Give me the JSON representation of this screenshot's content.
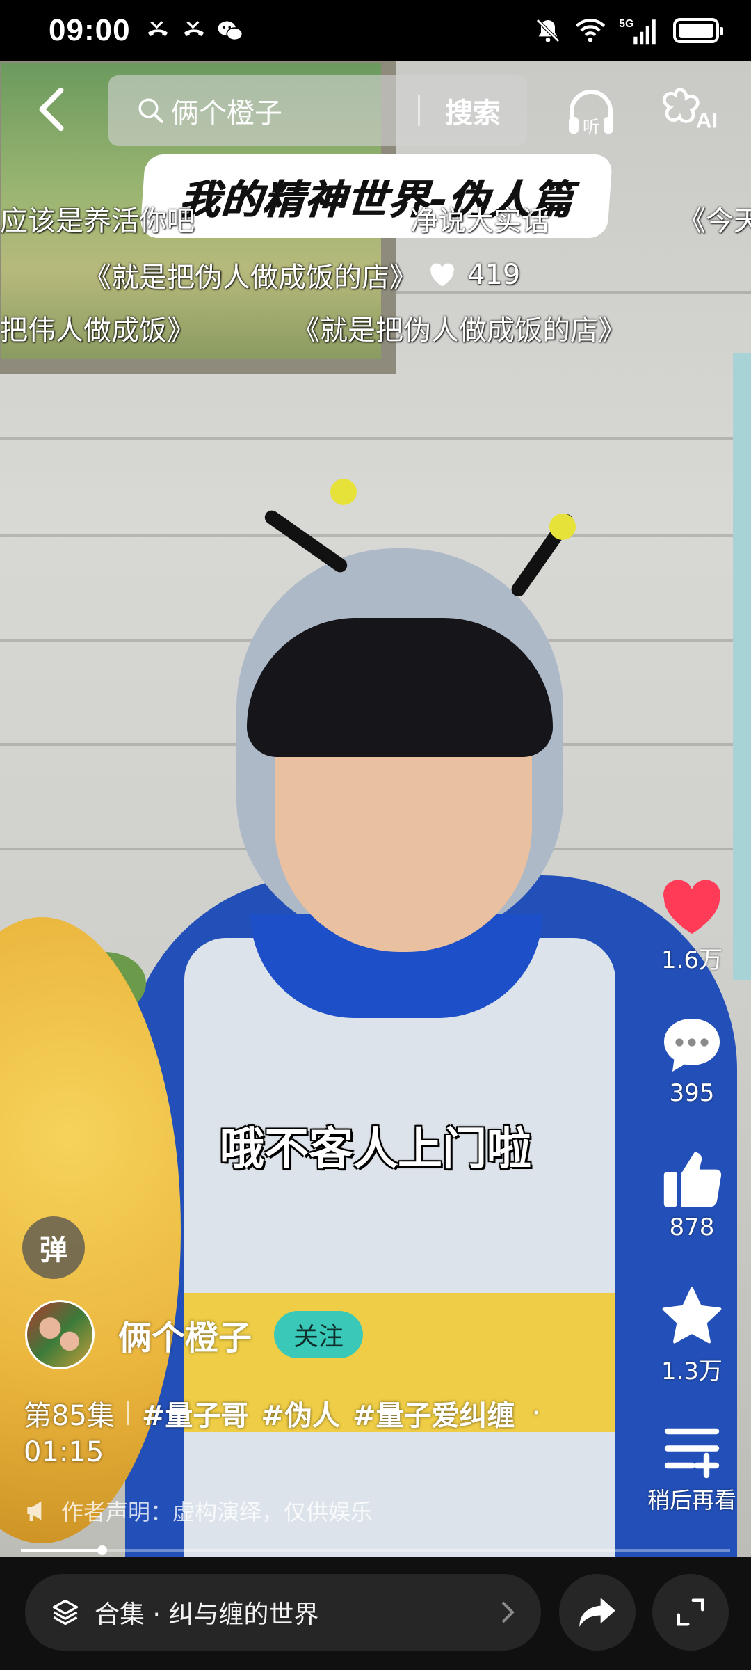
{
  "status_bar": {
    "time": "09:00",
    "left_icons": [
      "missed-call-icon",
      "missed-call-icon",
      "wechat-icon"
    ],
    "right_icons": [
      "mute-icon",
      "wifi-icon",
      "5g-signal-icon",
      "battery-icon"
    ],
    "network": "5G"
  },
  "top_bar": {
    "search_query": "俩个橙子",
    "search_button": "搜索",
    "listen_label": "听",
    "ai_label": "AI"
  },
  "video": {
    "title_sticker": "我的精神世界-伪人篇",
    "subtitle": "哦不客人上门啦"
  },
  "danmaku": {
    "row1": [
      "应该是养活你吧",
      "净说大实话",
      "《今天"
    ],
    "row2_text": "《就是把伪人做成饭的店》",
    "row2_likes": "419",
    "row3": [
      "把伟人做成饭》",
      "《就是把伪人做成饭的店》"
    ]
  },
  "actions": {
    "likes": "1.6万",
    "comments": "395",
    "recommends": "878",
    "favorites": "1.3万",
    "watch_later": "稍后再看"
  },
  "info": {
    "danmu_toggle": "弹",
    "author_name": "俩个橙子",
    "follow_label": "关注",
    "episode": "第85集",
    "tags": [
      "#量子哥",
      "#伪人",
      "#量子爱纠缠"
    ],
    "separator_dot": "·",
    "duration": "01:15",
    "disclaimer": "作者声明：虚构演绎，仅供娱乐"
  },
  "progress": {
    "played_fraction": 0.115
  },
  "bottom_bar": {
    "collection_label": "合集 · 纠与缠的世界"
  },
  "colors": {
    "like_red": "#ff3b57",
    "follow_teal": "#3ac9b8",
    "bottom_bg": "#101010"
  }
}
